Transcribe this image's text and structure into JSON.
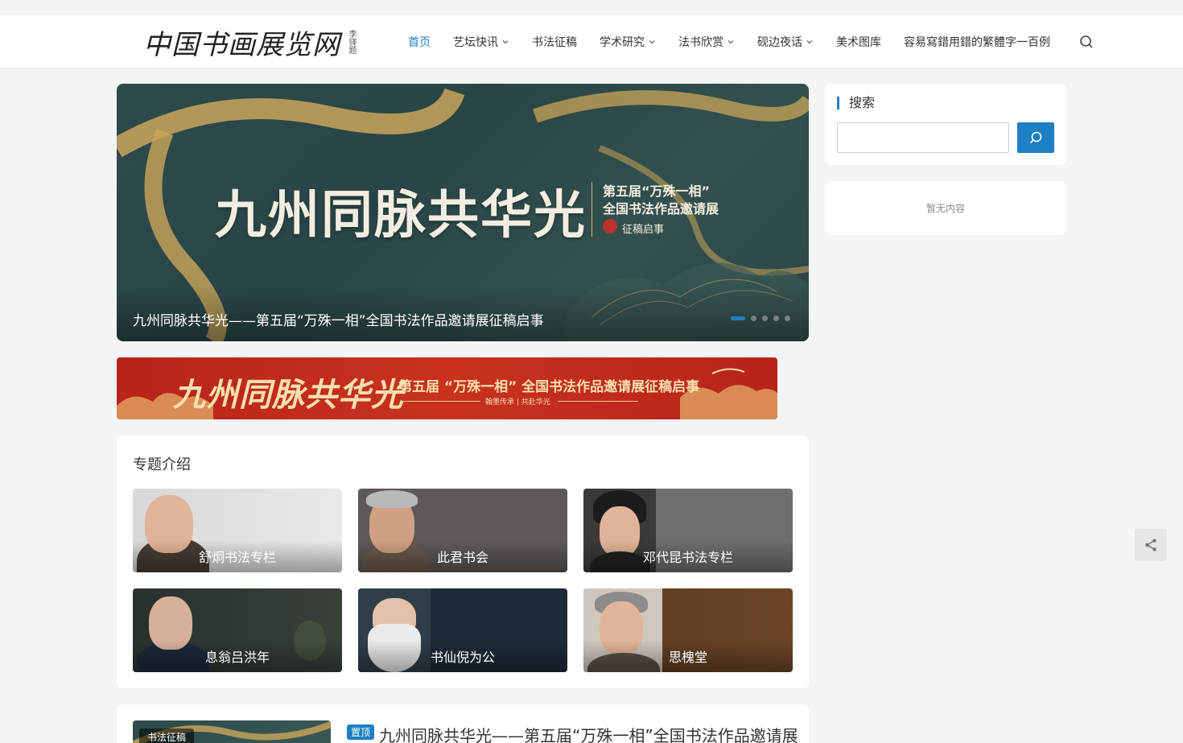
{
  "header": {
    "logo_text": "中国书画展览网",
    "logo_sign": "李铎题"
  },
  "nav": {
    "items": [
      {
        "label": "首页",
        "active": true,
        "dropdown": false
      },
      {
        "label": "艺坛快讯",
        "active": false,
        "dropdown": true
      },
      {
        "label": "书法征稿",
        "active": false,
        "dropdown": false
      },
      {
        "label": "学术研究",
        "active": false,
        "dropdown": true
      },
      {
        "label": "法书欣赏",
        "active": false,
        "dropdown": true
      },
      {
        "label": "砚边夜话",
        "active": false,
        "dropdown": true
      },
      {
        "label": "美术图库",
        "active": false,
        "dropdown": false
      },
      {
        "label": "容易寫錯用錯的繁體字一百例",
        "active": false,
        "dropdown": false
      }
    ],
    "search_icon": "search-icon"
  },
  "slider": {
    "headline": "九州同脉共华光",
    "sub1": "第五届“万殊一相”",
    "sub2": "全国书法作品邀请展",
    "sub3": "征稿启事",
    "caption": "九州同脉共华光——第五届“万殊一相”全国书法作品邀请展征稿启事",
    "active_slide": 1,
    "slide_count": 5
  },
  "banner": {
    "headline": "九州同脉共华光",
    "subtitle": "第五届 “万殊一相” 全国书法作品邀请展征稿启事",
    "tagline": "翰墨传承 | 共赴华光"
  },
  "topics": {
    "title": "专题介绍",
    "cards": [
      {
        "label": "舒炯书法专栏"
      },
      {
        "label": "此君书会"
      },
      {
        "label": "邓代昆书法专栏"
      },
      {
        "label": "息翁吕洪年"
      },
      {
        "label": "书仙倪为公"
      },
      {
        "label": "思槐堂"
      }
    ]
  },
  "post": {
    "category": "书法征稿",
    "badge": "置顶",
    "title": "九州同脉共华光——第五届“万殊一相”全国书法作品邀请展"
  },
  "sidebar": {
    "search_title": "搜索",
    "search_placeholder": "",
    "empty_text": "暂无内容"
  },
  "colors": {
    "accent": "#1e7fc4",
    "banner_red": "#c8321f",
    "gold": "#d4b36a"
  }
}
